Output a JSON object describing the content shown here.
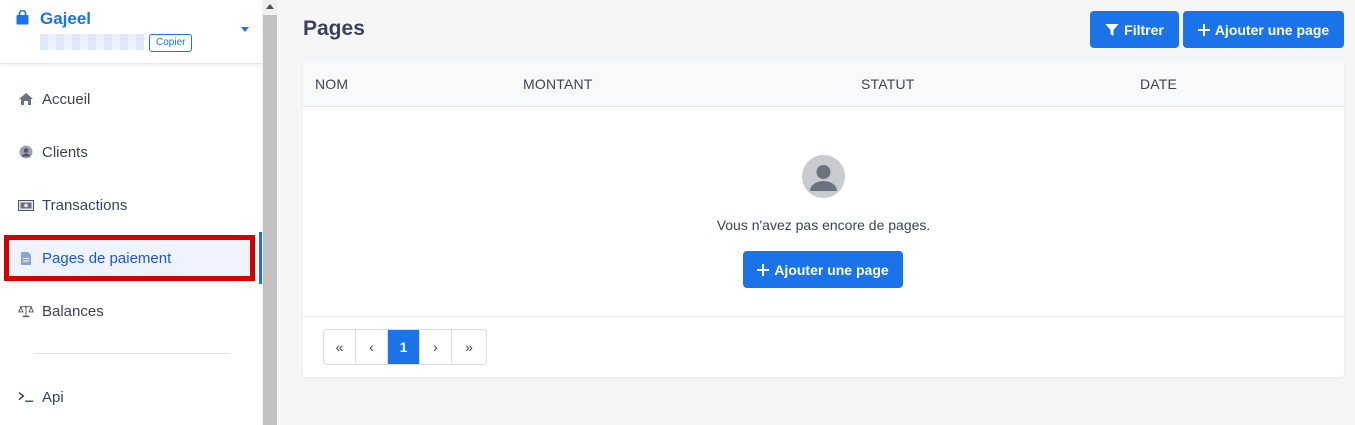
{
  "brand": {
    "name": "Gajeel",
    "copy_label": "Copier"
  },
  "sidebar": {
    "items": [
      {
        "label": "Accueil",
        "icon": "home-icon"
      },
      {
        "label": "Clients",
        "icon": "user-circle-icon"
      },
      {
        "label": "Transactions",
        "icon": "banknote-icon"
      },
      {
        "label": "Pages de paiement",
        "icon": "document-icon",
        "active": true
      },
      {
        "label": "Balances",
        "icon": "scale-icon"
      },
      {
        "label": "Api",
        "icon": "terminal-icon"
      }
    ]
  },
  "main": {
    "title": "Pages",
    "filter_label": "Filtrer",
    "add_label": "Ajouter une page",
    "table": {
      "columns": [
        "NOM",
        "MONTANT",
        "STATUT",
        "DATE"
      ],
      "rows": []
    },
    "empty": {
      "text": "Vous n'avez pas encore de pages.",
      "add_label": "Ajouter une page"
    },
    "pagination": {
      "first": "«",
      "prev": "‹",
      "current": "1",
      "next": "›",
      "last": "»"
    }
  },
  "colors": {
    "accent": "#1a73e8",
    "highlight_border": "#d40000",
    "active_bg": "#eef3fe"
  }
}
